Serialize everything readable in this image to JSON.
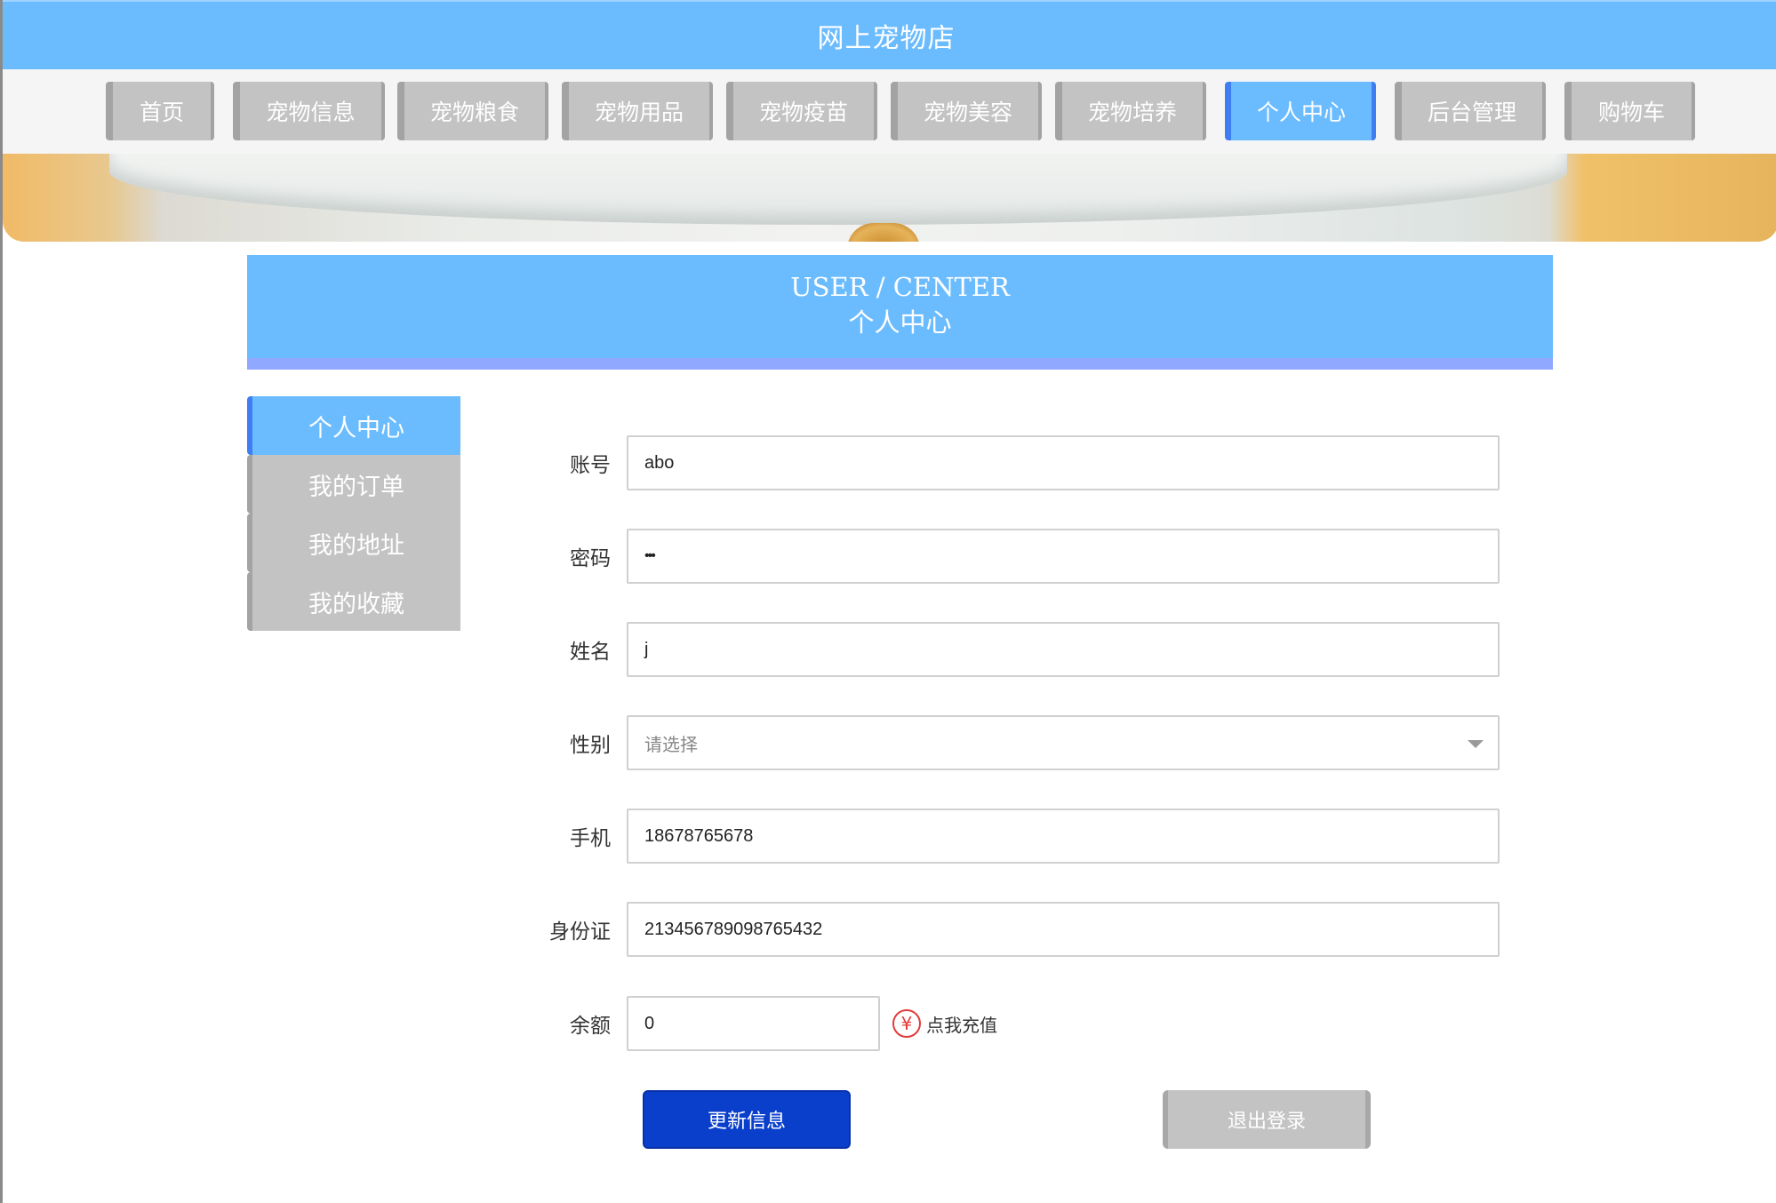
{
  "site": {
    "title": "网上宠物店"
  },
  "nav": {
    "items": [
      {
        "label": "首页"
      },
      {
        "label": "宠物信息"
      },
      {
        "label": "宠物粮食"
      },
      {
        "label": "宠物用品"
      },
      {
        "label": "宠物疫苗"
      },
      {
        "label": "宠物美容"
      },
      {
        "label": "宠物培养"
      },
      {
        "label": "个人中心"
      },
      {
        "label": "后台管理"
      },
      {
        "label": "购物车"
      }
    ],
    "active": "个人中心",
    "colors": {
      "active": "#6bbcff",
      "inactive": "#c3c3c3"
    }
  },
  "section": {
    "title_en": "USER / CENTER",
    "title_cn": "个人中心"
  },
  "side_menu": {
    "items": [
      {
        "label": "个人中心"
      },
      {
        "label": "我的订单"
      },
      {
        "label": "我的地址"
      },
      {
        "label": "我的收藏"
      }
    ],
    "active": "个人中心"
  },
  "form": {
    "account": {
      "label": "账号",
      "value": "abo"
    },
    "password": {
      "label": "密码",
      "value": "•••"
    },
    "name": {
      "label": "姓名",
      "value": "j"
    },
    "gender": {
      "label": "性别",
      "placeholder": "请选择"
    },
    "phone": {
      "label": "手机",
      "value": "18678765678"
    },
    "id_card": {
      "label": "身份证",
      "value": "213456789098765432"
    },
    "balance": {
      "label": "余额",
      "value": "0",
      "recharge_icon": "¥",
      "recharge_label": "点我充值"
    }
  },
  "actions": {
    "update_label": "更新信息",
    "logout_label": "退出登录"
  },
  "colors": {
    "primary": "#6bbcff",
    "accent_blue": "#0a3fcb",
    "recharge_red": "#e23b3b"
  },
  "icons": {
    "gender_dropdown": "chevron-down-icon",
    "recharge": "yuan-icon"
  }
}
